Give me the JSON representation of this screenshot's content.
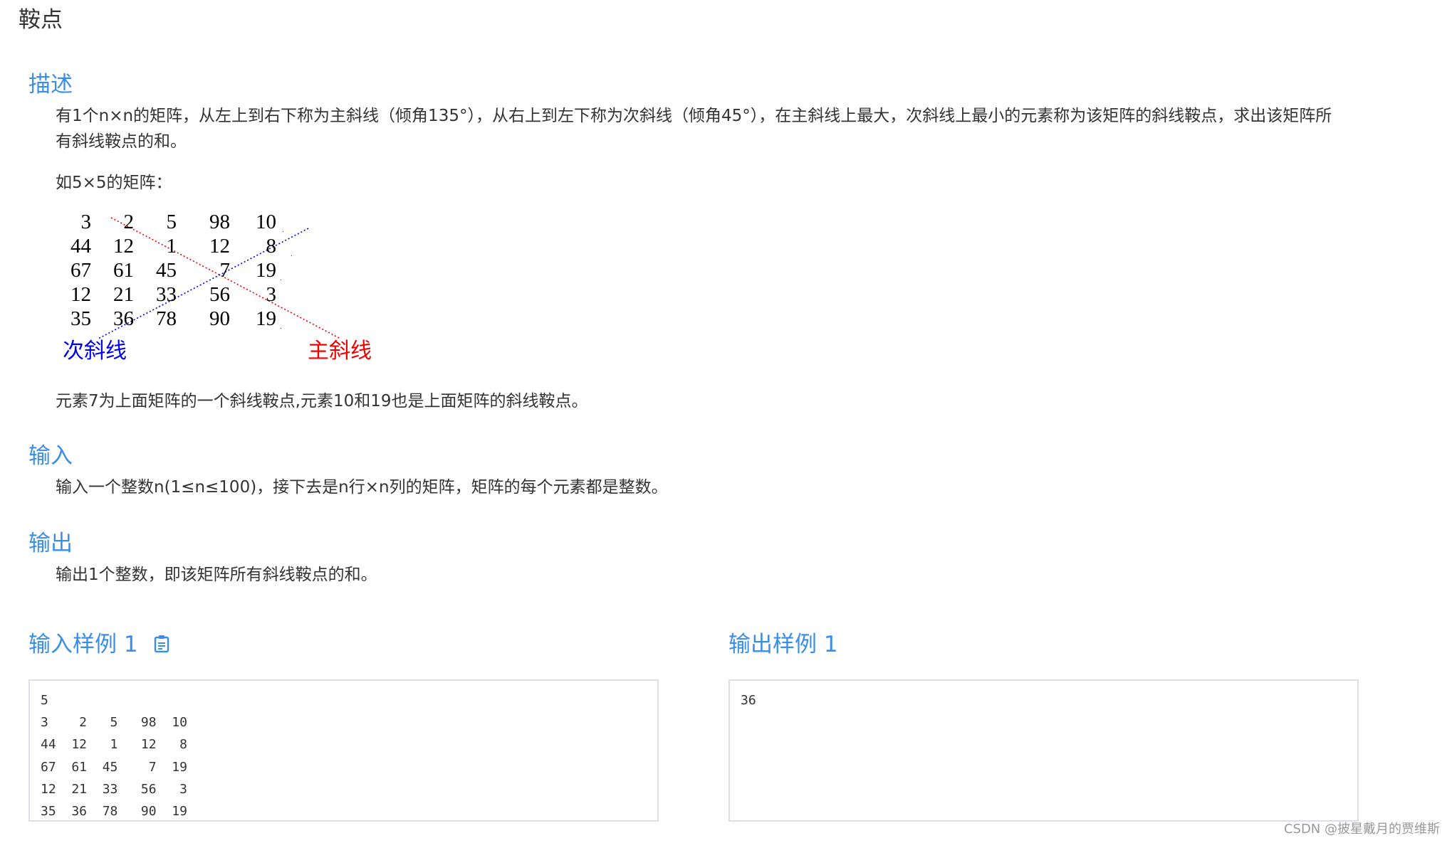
{
  "title": "鞍点",
  "description": {
    "heading": "描述",
    "paragraph1_line1": "有1个n×n的矩阵，从左上到右下称为主斜线（倾角135°），从右上到左下称为次斜线（倾角45°），在主斜线上最大，次斜线上最小的元素称为该矩阵的斜线鞍点，求出该矩阵所",
    "paragraph1_line2": "有斜线鞍点的和。",
    "example_intro": "如5×5的矩阵：",
    "matrix": [
      [
        "3",
        "2",
        "5",
        "98",
        "10"
      ],
      [
        "44",
        "12",
        "1",
        "12",
        "8"
      ],
      [
        "67",
        "61",
        "45",
        "7",
        "19"
      ],
      [
        "12",
        "21",
        "33",
        "56",
        "3"
      ],
      [
        "35",
        "36",
        "78",
        "90",
        "19"
      ]
    ],
    "secondary_diagonal_label": "次斜线",
    "main_diagonal_label": "主斜线",
    "secondary_color": "#0000ee",
    "main_color": "#ee0000",
    "paragraph2": "元素7为上面矩阵的一个斜线鞍点,元素10和19也是上面矩阵的斜线鞍点。"
  },
  "input": {
    "heading": "输入",
    "text": "输入一个整数n(1≤n≤100)，接下去是n行×n列的矩阵，矩阵的每个元素都是整数。"
  },
  "output": {
    "heading": "输出",
    "text": "输出1个整数，即该矩阵所有斜线鞍点的和。"
  },
  "sample_input": {
    "heading": "输入样例 1",
    "icon": "clipboard-icon",
    "content": "5\n3    2   5   98  10\n44  12   1   12   8\n67  61  45    7  19\n12  21  33   56   3\n35  36  78   90  19"
  },
  "sample_output": {
    "heading": "输出样例 1",
    "content": "36"
  },
  "watermark": "CSDN @披星戴月的贾维斯",
  "accent_color": "#3a8ee6"
}
